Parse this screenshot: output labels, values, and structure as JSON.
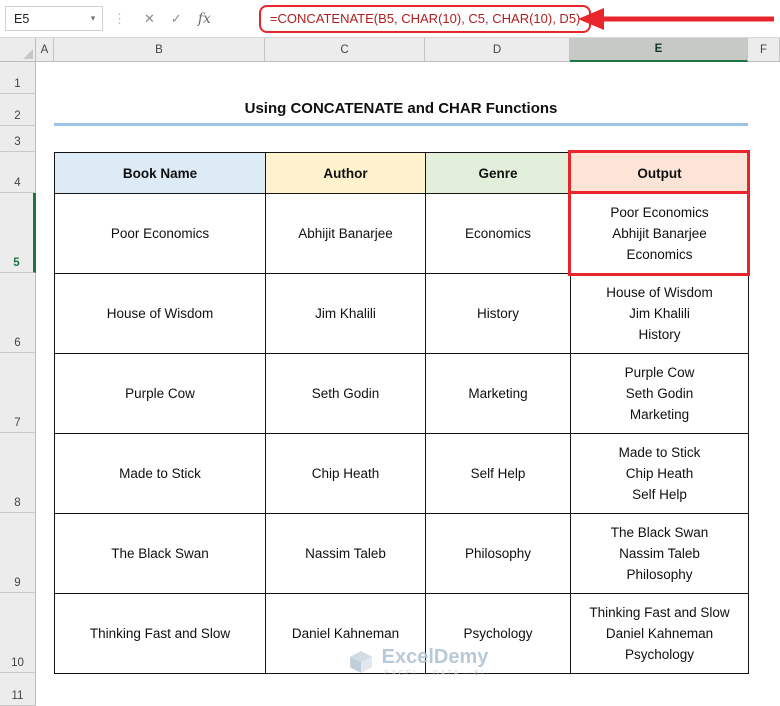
{
  "formula_bar": {
    "name_box_value": "E5",
    "dropdown_glyph": "▾",
    "divider_glyph": "⋮",
    "cancel_glyph": "✕",
    "enter_glyph": "✓",
    "fx_label": "fx",
    "formula": "=CONCATENATE(B5, CHAR(10), C5, CHAR(10), D5)"
  },
  "column_headers": [
    "A",
    "B",
    "C",
    "D",
    "E",
    "F"
  ],
  "row_headers": [
    "1",
    "2",
    "3",
    "4",
    "5",
    "6",
    "7",
    "8",
    "9",
    "10",
    "11"
  ],
  "selection": {
    "active_cell": "E5",
    "selected_column": "E",
    "selected_row": "5"
  },
  "sheet": {
    "title": "Using CONCATENATE and CHAR Functions",
    "table": {
      "headers": [
        "Book Name",
        "Author",
        "Genre",
        "Output"
      ],
      "rows": [
        {
          "book": "Poor Economics",
          "author": "Abhijit Banarjee",
          "genre": "Economics",
          "output_lines": [
            "Poor Economics",
            "Abhijit Banarjee",
            "Economics"
          ]
        },
        {
          "book": "House of Wisdom",
          "author": "Jim Khalili",
          "genre": "History",
          "output_lines": [
            "House of Wisdom",
            "Jim Khalili",
            "History"
          ]
        },
        {
          "book": "Purple Cow",
          "author": "Seth Godin",
          "genre": "Marketing",
          "output_lines": [
            "Purple Cow",
            "Seth Godin",
            "Marketing"
          ]
        },
        {
          "book": "Made to Stick",
          "author": "Chip Heath",
          "genre": "Self Help",
          "output_lines": [
            "Made to Stick",
            "Chip Heath",
            "Self Help"
          ]
        },
        {
          "book": "The Black Swan",
          "author": "Nassim Taleb",
          "genre": "Philosophy",
          "output_lines": [
            "The Black Swan",
            "Nassim Taleb",
            "Philosophy"
          ]
        },
        {
          "book": "Thinking Fast and Slow",
          "author": "Daniel Kahneman",
          "genre": "Psychology",
          "output_lines": [
            "Thinking Fast and Slow",
            "Daniel Kahneman",
            "Psychology"
          ]
        }
      ]
    }
  },
  "watermark": {
    "brand": "ExcelDemy",
    "tagline": "EXCEL · DATA · BI"
  },
  "colors": {
    "header_book": "#DDEBF7",
    "header_author": "#FFF2CC",
    "header_genre": "#E2EFDA",
    "header_output": "#FCE4D6",
    "annotation_red": "#E8252B",
    "formula_text": "#B11E1E",
    "title_underline": "#9DC3E6",
    "excel_green": "#217346"
  }
}
